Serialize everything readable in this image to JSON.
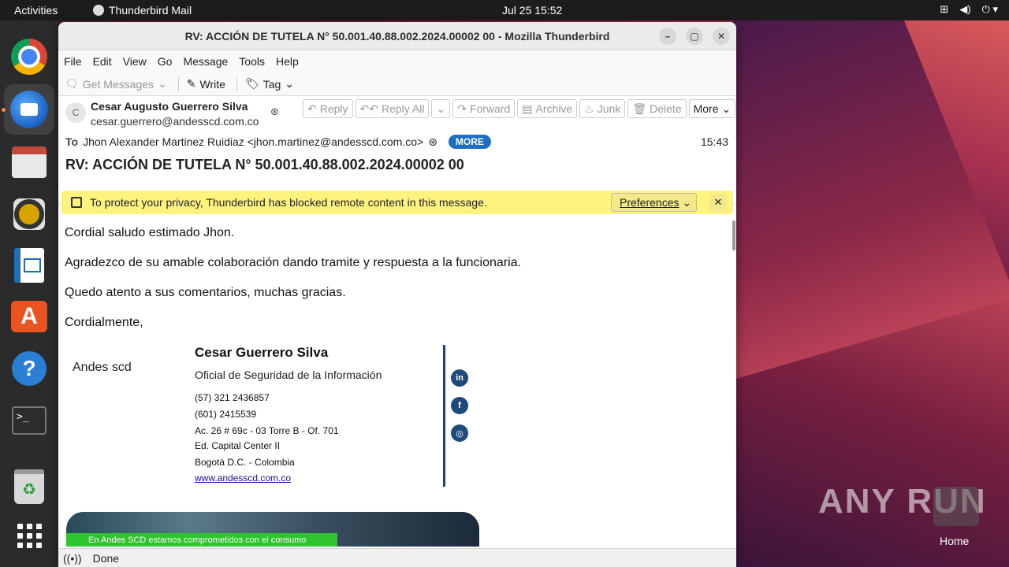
{
  "topbar": {
    "activities": "Activities",
    "app_name": "Thunderbird Mail",
    "clock": "Jul 25  15:52"
  },
  "window": {
    "title": "RV: ACCIÓN DE TUTELA N° 50.001.40.88.002.2024.00002 00 - Mozilla Thunderbird"
  },
  "menu": [
    "File",
    "Edit",
    "View",
    "Go",
    "Message",
    "Tools",
    "Help"
  ],
  "toolbar": {
    "get_messages": "Get Messages",
    "write": "Write",
    "tag": "Tag"
  },
  "message": {
    "from_name": "Cesar Augusto Guerrero Silva",
    "from_email": "cesar.guerrero@andesscd.com.co",
    "avatar_letter": "C",
    "actions": {
      "reply": "Reply",
      "reply_all": "Reply All",
      "forward": "Forward",
      "archive": "Archive",
      "junk": "Junk",
      "delete": "Delete",
      "more": "More"
    },
    "to_label": "To",
    "to_value": "Jhon Alexander Martinez Ruidiaz <jhon.martinez@andesscd.com.co>",
    "more_badge": "MORE",
    "time": "15:43",
    "subject": "RV: ACCIÓN DE TUTELA N° 50.001.40.88.002.2024.00002 00"
  },
  "notice": {
    "text": "To protect your privacy, Thunderbird has blocked remote content in this message.",
    "preferences": "Preferences"
  },
  "body": {
    "lines": [
      "Cordial saludo estimado Jhon.",
      "Agradezco de su amable colaboración dando tramite y respuesta a la funcionaria.",
      "Quedo atento a sus comentarios, muchas gracias.",
      "Cordialmente,"
    ]
  },
  "signature": {
    "company": "Andes scd",
    "name": "Cesar Guerrero Silva",
    "title": "Oficial de Seguridad de la Información",
    "phone1": "(57) 321 2436857",
    "phone2": "(601) 2415539",
    "address1": "Ac. 26 # 69c - 03 Torre B - Of. 701",
    "address2": "Ed. Capital Center II",
    "city": "Bogotá D.C. - Colombia",
    "website": "www.andesscd.com.co",
    "banner_text": "En Andes SCD estamos comprometidos con el consumo"
  },
  "statusbar": {
    "status": "Done"
  },
  "desktop": {
    "watermark": "ANY RUN",
    "home_label": "Home"
  },
  "colors": {
    "accent": "#1d6fc2",
    "notice_bg": "#fff380",
    "signature_divider": "#1f3f77"
  }
}
